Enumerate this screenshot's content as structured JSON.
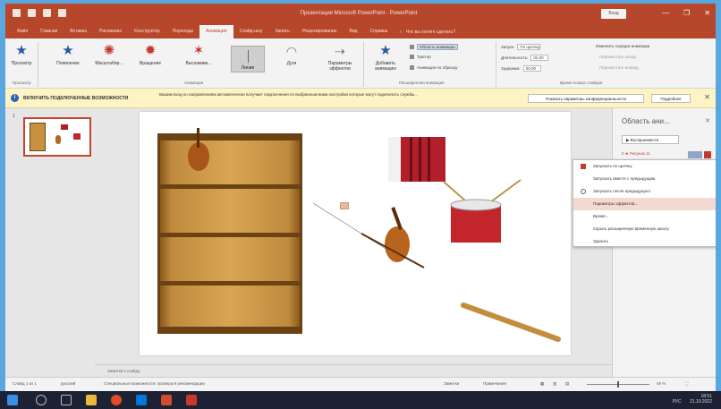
{
  "app": {
    "title": "Презентация Microsoft PowerPoint - PowerPoint",
    "signin_label": "Вход",
    "accent": "#b7472a"
  },
  "tabs": [
    {
      "label": "Файл"
    },
    {
      "label": "Главная"
    },
    {
      "label": "Вставка"
    },
    {
      "label": "Рисование"
    },
    {
      "label": "Конструктор"
    },
    {
      "label": "Переходы"
    },
    {
      "label": "Анимация",
      "active": true
    },
    {
      "label": "Слайд-шоу"
    },
    {
      "label": "Запись"
    },
    {
      "label": "Рецензирование"
    },
    {
      "label": "Вид"
    },
    {
      "label": "Справка"
    }
  ],
  "tellme": "Что вы хотите сделать?",
  "ribbon": {
    "preview": "Просмотр",
    "group_preview": "Просмотр",
    "anims": [
      "Появление",
      "Масштабир...",
      "Вращение",
      "Выскакива...",
      "Линии",
      "Дуги"
    ],
    "effect_params": "Параметры эффектов",
    "group_anim": "Анимация",
    "add_anim": "Добавить анимацию",
    "anim_pane": "Область анимации",
    "trigger": "Триггер",
    "anim_painter": "Анимация по образцу",
    "group_adv": "Расширенная анимация",
    "start_label": "Запуск:",
    "start_value": "По щелчку",
    "duration_label": "Длительность:",
    "duration_value": "02,00",
    "delay_label": "Задержка:",
    "delay_value": "00,00",
    "reorder": "Изменить порядок анимации",
    "move_earlier": "Переместить назад",
    "move_later": "Переместить вперед",
    "group_timing": "Время показа слайдов"
  },
  "msgbar": {
    "title": "ВКЛЮЧИТЬ ПОДКЛЮЧЕННЫЕ ВОЗМОЖНОСТИ",
    "text": "Вашим вход по направлениям автоматически получает подключения по выбранным вами настройки которые могут подключать службы...",
    "btn1": "Показать параметры конфиденциальности",
    "btn2": "Подробнее"
  },
  "thumbs": {
    "num": "1"
  },
  "notes": {
    "placeholder": "Заметки к слайду"
  },
  "anipane": {
    "title": "Область ани...",
    "play": "▶ Воспроизвести",
    "entry": "0 ★ Рисунок 11"
  },
  "ctxmenu": [
    {
      "label": "Запускать по щелчку",
      "icon": "mouse-icon"
    },
    {
      "label": "Запускать вместе с предыдущим",
      "icon": "blank-icon"
    },
    {
      "label": "Запускать после предыдущего",
      "icon": "clock-icon"
    },
    {
      "label": "Параметры эффектов...",
      "icon": "blank-icon",
      "hover": true
    },
    {
      "label": "Время...",
      "icon": "blank-icon"
    },
    {
      "label": "Скрыть расширенную временную шкалу",
      "icon": "blank-icon"
    },
    {
      "label": "Удалить",
      "icon": "blank-icon"
    }
  ],
  "status": {
    "slide": "Слайд 1 из 1",
    "lang": "русский",
    "accessibility": "Специальные возможности: проверьте рекомендации",
    "notes_btn": "Заметки",
    "comments_btn": "Примечания",
    "zoom": "49 %"
  },
  "taskbar": {
    "clock": "18:51",
    "date": "21.10.2022",
    "lang": "РУС"
  }
}
